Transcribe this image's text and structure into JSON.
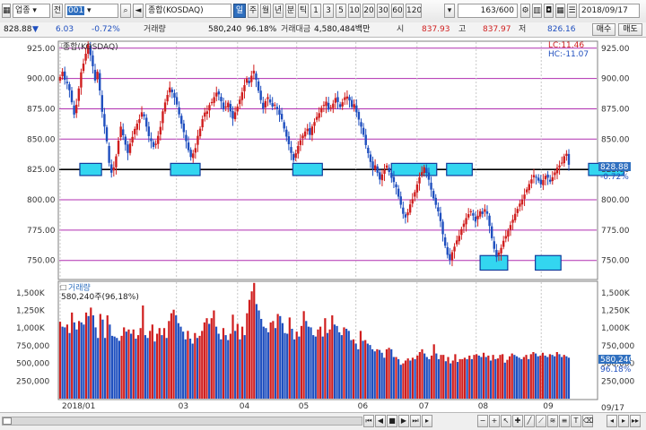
{
  "toolbar": {
    "sector_select": "업종",
    "tab_jeon": "전",
    "code_input": "001",
    "name_field": "종합(KOSDAQ)",
    "period_buttons": [
      "주",
      "월",
      "년",
      "분",
      "틱",
      "1",
      "3",
      "5",
      "10",
      "20",
      "30",
      "60",
      "120"
    ],
    "count_field": "163/600",
    "date_field": "2018/09/17"
  },
  "info": {
    "price": "828.88",
    "arrow": "▼",
    "change": "6.03",
    "change_pct": "-0.72%",
    "volume_label": "거래량",
    "volume_value": "580,240",
    "volume_ratio": "96.18%",
    "amount_label": "거래대금",
    "amount_value": "4,580,484백만",
    "open_label": "시",
    "open_value": "837.93",
    "high_label": "고",
    "high_value": "837.97",
    "low_label": "저",
    "low_value": "826.16",
    "buy_button": "매수",
    "sell_button": "매도"
  },
  "colors": {
    "up": "#d01e1e",
    "down": "#1f4fbf",
    "ref_line": "#b02eb0",
    "highlight_fill": "#33d6f0",
    "highlight_border": "#103c9c"
  },
  "chart_data": [
    {
      "type": "candlestick",
      "title": "종합(KOSDAQ)",
      "y_ticks": [
        "925.00",
        "900.00",
        "875.00",
        "850.00",
        "825.00",
        "800.00",
        "775.00",
        "750.00"
      ],
      "ylim": [
        735,
        930
      ],
      "reference_lines": [
        925,
        900,
        875,
        850,
        800,
        775,
        750
      ],
      "support_line": 825,
      "lc_label": "LC:11.46",
      "hc_label": "HC:-11.07",
      "current_price_tag": "828.88",
      "current_pct_tag": "-0.72%",
      "x_labels": [
        "2018/01",
        "03",
        "04",
        "05",
        "06",
        "07",
        "08",
        "09"
      ],
      "x_label_dates": [
        "2018-01-02",
        "2018-03-02",
        "2018-04-02",
        "2018-05-02",
        "2018-06-01",
        "2018-07-02",
        "2018-08-01",
        "2018-09-03"
      ],
      "corner_date_label": "09/17",
      "highlight_boxes": [
        {
          "start": "2018-01-12",
          "end": "2018-01-23",
          "low": 820,
          "high": 830
        },
        {
          "start": "2018-02-27",
          "end": "2018-03-14",
          "low": 820,
          "high": 830
        },
        {
          "start": "2018-04-30",
          "end": "2018-05-15",
          "low": 820,
          "high": 830
        },
        {
          "start": "2018-06-19",
          "end": "2018-07-12",
          "low": 820,
          "high": 830
        },
        {
          "start": "2018-07-17",
          "end": "2018-07-30",
          "low": 820,
          "high": 830
        },
        {
          "start": "2018-08-03",
          "end": "2018-08-17",
          "low": 742,
          "high": 754
        },
        {
          "start": "2018-08-31",
          "end": "2018-09-13",
          "low": 742,
          "high": 754
        },
        {
          "start": "2018-09-27",
          "end": "2018-10-15",
          "low": 820,
          "high": 830
        }
      ],
      "closes": [
        901.23,
        905.56,
        898.9,
        896.12,
        890.34,
        880.41,
        870.25,
        878.33,
        891.77,
        905.12,
        912.34,
        920.41,
        928.5,
        919.22,
        910.11,
        898.32,
        905.54,
        890.11,
        872.54,
        860.33,
        848.21,
        830.45,
        822.33,
        826.6,
        835.81,
        848.75,
        860.3,
        853.21,
        845.44,
        838.61,
        846.35,
        851.83,
        858.4,
        862.76,
        866.4,
        872.15,
        868.9,
        860.33,
        852.47,
        848.4,
        843.6,
        846.2,
        852.7,
        860.1,
        872.9,
        880.22,
        886.4,
        892.6,
        888.7,
        884.3,
        878.55,
        870.44,
        862.68,
        855.8,
        848.33,
        840.9,
        835.2,
        838.2,
        842.6,
        852.7,
        858.6,
        866.5,
        871.9,
        872.88,
        878.1,
        880.5,
        884.6,
        888.3,
        886.9,
        881.2,
        874.5,
        876.9,
        880.1,
        872.86,
        866.9,
        872.1,
        876.9,
        882.5,
        888.6,
        894.5,
        899.9,
        896.1,
        902.3,
        906.4,
        898.9,
        889.9,
        882.2,
        875.2,
        881.4,
        884.6,
        880.2,
        876.9,
        878.4,
        874.8,
        870.2,
        866.3,
        858.8,
        852.1,
        845.8,
        838.6,
        832.7,
        838.3,
        844.4,
        849.1,
        852.9,
        856.3,
        858.6,
        853.5,
        860.4,
        864.1,
        868.3,
        871.4,
        875.8,
        878.2,
        880.9,
        874.3,
        876.3,
        879.3,
        883.9,
        880.6,
        876.4,
        880.4,
        884.5,
        885.2,
        881.9,
        876.5,
        878.8,
        872.1,
        866.1,
        860.3,
        853.6,
        845.1,
        838.4,
        831.2,
        825.7,
        828.4,
        822.3,
        816.7,
        820.9,
        824.6,
        828.3,
        822.9,
        818.1,
        814.6,
        810.3,
        802.6,
        795.9,
        788.4,
        785.4,
        789.6,
        796.2,
        800.5,
        806.3,
        812.6,
        818.5,
        822.7,
        826.9,
        822.1,
        816.5,
        808.4,
        801.2,
        795.8,
        790.4,
        782.4,
        771.6,
        762.1,
        754.6,
        750.5,
        756.8,
        761.3,
        766.5,
        770.2,
        775.8,
        780.3,
        784.9,
        788.2,
        790.6,
        786.9,
        782.1,
        786.8,
        790.6,
        788.3,
        792.2,
        788.4,
        778.4,
        768.3,
        759.6,
        752.8,
        756.4,
        760.3,
        766.2,
        770.1,
        774.5,
        779.2,
        783.6,
        788.4,
        792.5,
        796.8,
        800.2,
        804.3,
        808.5,
        812.9,
        816.8,
        820.4,
        818.6,
        815.8,
        812.7,
        816.3,
        819.8,
        818.2,
        814.9,
        818.6,
        822.5,
        826.4,
        828.3,
        830.6,
        835.9,
        837.9,
        828.88
      ],
      "series_volume": {
        "title": "거래량",
        "summary": "580,240주(96,18%)",
        "y_ticks": [
          "1,500K",
          "1,250K",
          "1,000K",
          "750,000",
          "500,000",
          "250,000"
        ],
        "ylim": [
          0,
          1650000
        ],
        "current_tag": "580,240",
        "current_pct_tag": "96.18%",
        "values": [
          1090000,
          1020000,
          1010000,
          1050000,
          930000,
          1220000,
          1080000,
          980000,
          1100000,
          1080000,
          1050000,
          1220000,
          1170000,
          1290000,
          1180000,
          1010000,
          860000,
          1200000,
          1120000,
          860000,
          1180000,
          1050000,
          890000,
          880000,
          860000,
          820000,
          890000,
          1010000,
          950000,
          980000,
          920000,
          980000,
          850000,
          900000,
          1000000,
          1320000,
          900000,
          860000,
          960000,
          1050000,
          810000,
          920000,
          1000000,
          900000,
          1000000,
          860000,
          1100000,
          1210000,
          1260000,
          1180000,
          1070000,
          1020000,
          950000,
          840000,
          960000,
          850000,
          780000,
          930000,
          860000,
          890000,
          960000,
          1080000,
          1140000,
          1060000,
          1140000,
          1250000,
          1020000,
          920000,
          840000,
          1000000,
          900000,
          830000,
          920000,
          1190000,
          960000,
          1060000,
          840000,
          1020000,
          900000,
          1210000,
          1400000,
          1520000,
          1640000,
          1340000,
          1250000,
          1130000,
          1020000,
          1000000,
          940000,
          1080000,
          1100000,
          1000000,
          1200000,
          1170000,
          1070000,
          930000,
          920000,
          1150000,
          990000,
          840000,
          950000,
          880000,
          1030000,
          1240000,
          1100000,
          1020000,
          1010000,
          900000,
          880000,
          980000,
          1020000,
          880000,
          1140000,
          930000,
          980000,
          1180000,
          1050000,
          1030000,
          940000,
          900000,
          1010000,
          990000,
          960000,
          830000,
          840000,
          780000,
          700000,
          960000,
          820000,
          830000,
          780000,
          760000,
          700000,
          670000,
          700000,
          690000,
          650000,
          580000,
          700000,
          720000,
          700000,
          590000,
          590000,
          560000,
          480000,
          500000,
          540000,
          570000,
          540000,
          580000,
          560000,
          610000,
          660000,
          700000,
          640000,
          590000,
          560000,
          610000,
          770000,
          640000,
          560000,
          620000,
          620000,
          530000,
          590000,
          500000,
          540000,
          630000,
          520000,
          560000,
          560000,
          580000,
          560000,
          610000,
          560000,
          620000,
          630000,
          610000,
          590000,
          650000,
          590000,
          610000,
          540000,
          620000,
          560000,
          570000,
          620000,
          630000,
          510000,
          550000,
          600000,
          640000,
          620000,
          600000,
          580000,
          560000,
          590000,
          620000,
          560000,
          630000,
          660000,
          640000,
          600000,
          610000,
          650000,
          610000,
          590000,
          630000,
          620000,
          600000,
          660000,
          630000,
          590000,
          620000,
          600000,
          580240
        ]
      }
    }
  ]
}
